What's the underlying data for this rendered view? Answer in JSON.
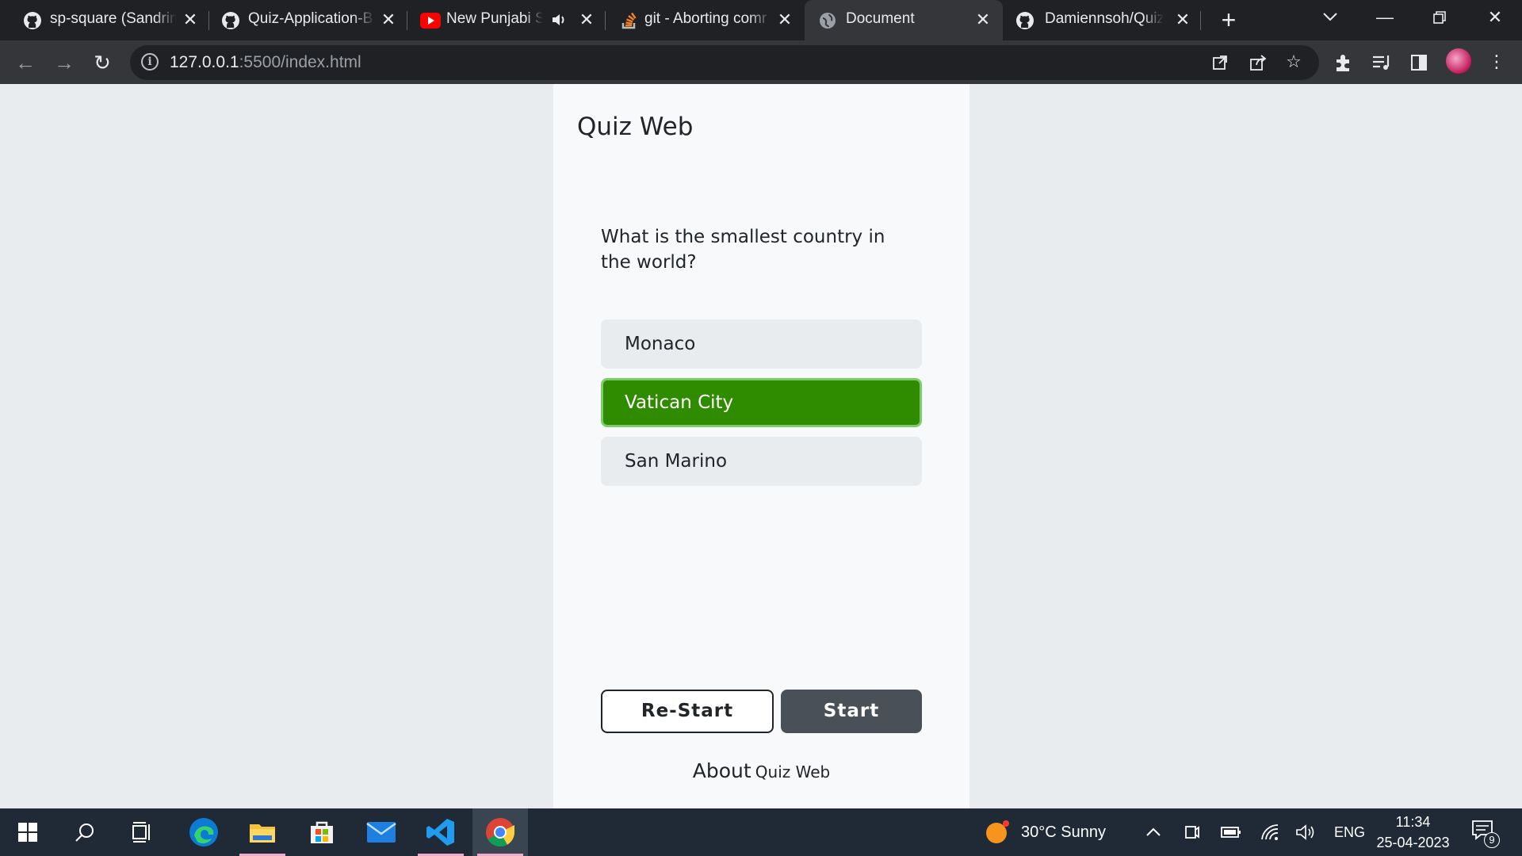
{
  "browser": {
    "tabs": [
      {
        "title": "sp-square (Sandrine",
        "icon": "github-icon"
      },
      {
        "title": "Quiz-Application-B",
        "icon": "github-icon"
      },
      {
        "title": "New Punjabi So",
        "icon": "youtube-icon",
        "audio": true
      },
      {
        "title": "git - Aborting comr",
        "icon": "stackoverflow-icon"
      },
      {
        "title": "Document",
        "icon": "globe-icon",
        "active": true
      },
      {
        "title": "Damiennsoh/Quiz-",
        "icon": "github-icon"
      }
    ],
    "address": {
      "host": "127.0.0.1",
      "rest": ":5500/index.html"
    }
  },
  "page": {
    "brand": "Quiz Web",
    "question": "What is the smallest country in the world?",
    "options": [
      {
        "label": "Monaco",
        "state": "default"
      },
      {
        "label": "Vatican City",
        "state": "correct"
      },
      {
        "label": "San Marino",
        "state": "default"
      }
    ],
    "restart_label": "Re-Start",
    "start_label": "Start",
    "about_prefix": "About",
    "about_brand": "Quiz Web"
  },
  "taskbar": {
    "weather": "30°C  Sunny",
    "language": "ENG",
    "time": "11:34",
    "date": "25-04-2023",
    "notification_count": "9"
  },
  "colors": {
    "correct_bg": "#2f8b00",
    "correct_border": "#7ccd6a",
    "start_bg": "#495057",
    "chrome_dark": "#202124",
    "chrome_toolbar": "#35363a"
  }
}
